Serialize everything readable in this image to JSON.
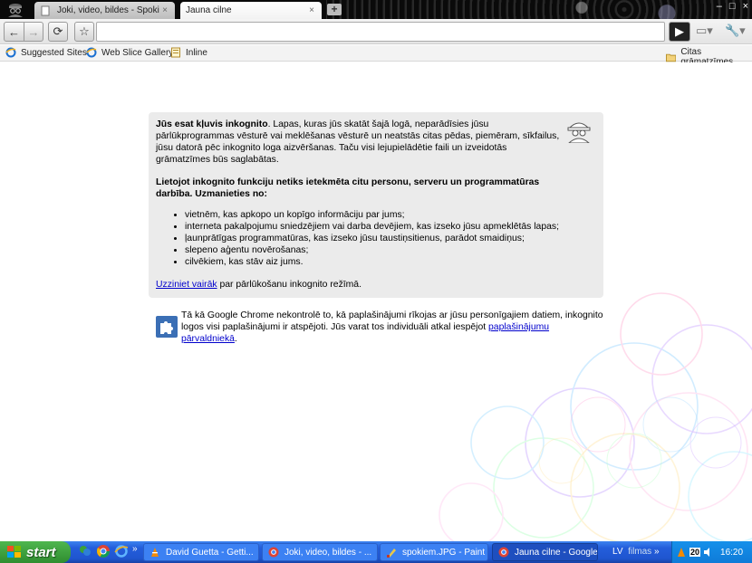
{
  "tabs": [
    {
      "label": "Joki, video, bildes - Spoki",
      "close": "×"
    },
    {
      "label": "Jauna cilne",
      "close": "×"
    }
  ],
  "new_tab": "+",
  "window_controls": [
    "–",
    "□",
    "×"
  ],
  "toolbar": {
    "back_icon": "←",
    "forward_icon": "→",
    "reload_icon": "⟳",
    "star_icon": "☆",
    "omnibox_value": "",
    "go_icon": "▶",
    "page_menu_icon": "▭▾",
    "wrench_icon": "🔧▾"
  },
  "bookmarks": [
    {
      "label": "Suggested Sites",
      "icon": "ie-icon"
    },
    {
      "label": "Web Slice Gallery",
      "icon": "ie-icon"
    },
    {
      "label": "Inline",
      "icon": "page-icon"
    },
    {
      "label": "Citas grāmatzīmes",
      "icon": "folder-icon"
    }
  ],
  "incognito": {
    "intro_bold": "Jūs esat kļuvis inkognito",
    "intro_rest": ". Lapas, kuras jūs skatāt šajā logā, neparādīsies jūsu pārlūkprogrammas vēsturē vai meklēšanas vēsturē un neatstās citas pēdas, piemēram, sīkfailus, jūsu datorā pēc inkognito loga aizvēršanas. Taču visi lejupielādētie faili un izveidotās grāmatzīmes būs saglabātas.",
    "warning": "Lietojot inkognito funkciju netiks ietekmēta citu personu, serveru un programmatūras darbība. Uzmanieties no:",
    "items": [
      "vietnēm, kas apkopo un kopīgo informāciju par jums;",
      "interneta pakalpojumu sniedzējiem vai darba devējiem, kas izseko jūsu apmeklētās lapas;",
      "ļaunprātīgas programmatūras, kas izseko jūsu taustiņsitienus, parādot smaidiņus;",
      "slepeno aģentu novērošanas;",
      "cilvēkiem, kas stāv aiz jums."
    ],
    "learn_more_link": "Uzziniet vairāk",
    "learn_more_rest": " par pārlūkošanu inkognito režīmā."
  },
  "extensions": {
    "text": "Tā kā Google Chrome nekontrolē to, kā paplašinājumi rīkojas ar jūsu personīgajiem datiem, inkognito logos visi paplašinājumi ir atspējoti. Jūs varat tos individuāli atkal iespējot ",
    "link": "paplašinājumu pārvaldniekā",
    "end": "."
  },
  "taskbar": {
    "start": "start",
    "tasks": [
      {
        "label": "David Guetta - Getti...",
        "icon": "vlc-icon"
      },
      {
        "label": "Joki, video, bildes - ...",
        "icon": "chrome-icon"
      },
      {
        "label": "spokiem.JPG - Paint",
        "icon": "paint-icon"
      },
      {
        "label": "Jauna cilne - Google ...",
        "icon": "chrome-icon"
      }
    ],
    "lang": "LV",
    "toolbar_label": "filmas",
    "tray_badge": "20",
    "clock": "16:20",
    "quick_more": "»"
  },
  "colors": {
    "link": "#0000cc",
    "taskbar_blue": "#245edb",
    "start_green": "#3a9d3a",
    "infobox_bg": "#ebebeb"
  }
}
